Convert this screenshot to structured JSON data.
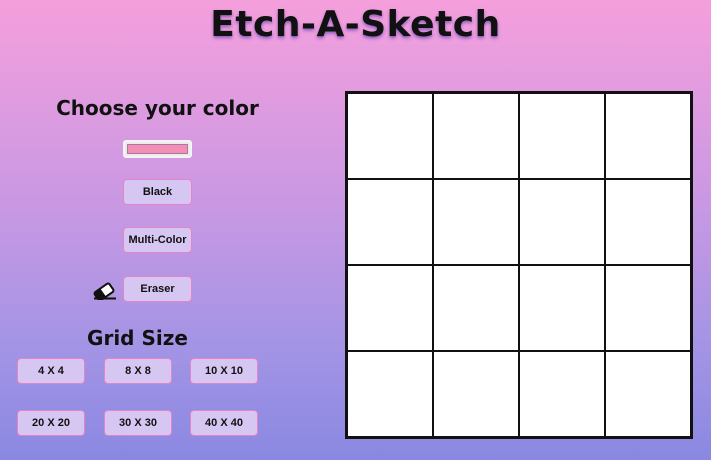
{
  "title": "Etch-A-Sketch",
  "color_panel": {
    "heading": "Choose your color",
    "color_input_value": "#f58eb6",
    "buttons": {
      "black": "Black",
      "multi_color": "Multi-Color",
      "eraser": "Eraser"
    },
    "eraser_icon": "eraser-icon"
  },
  "grid_panel": {
    "heading": "Grid Size",
    "sizes": [
      "4 X 4",
      "8 X 8",
      "10 X 10",
      "20 X 20",
      "30 X 30",
      "40 X 40"
    ]
  },
  "canvas": {
    "rows": 4,
    "cols": 4,
    "cell_color": "#ffffff",
    "border_color": "#111111"
  },
  "colors": {
    "background_top": "#f59fdc",
    "background_bottom": "#8a88e2",
    "button_bg": "#d6c6f2",
    "button_border": "#e682c8",
    "selected_color": "#f58eb6"
  }
}
